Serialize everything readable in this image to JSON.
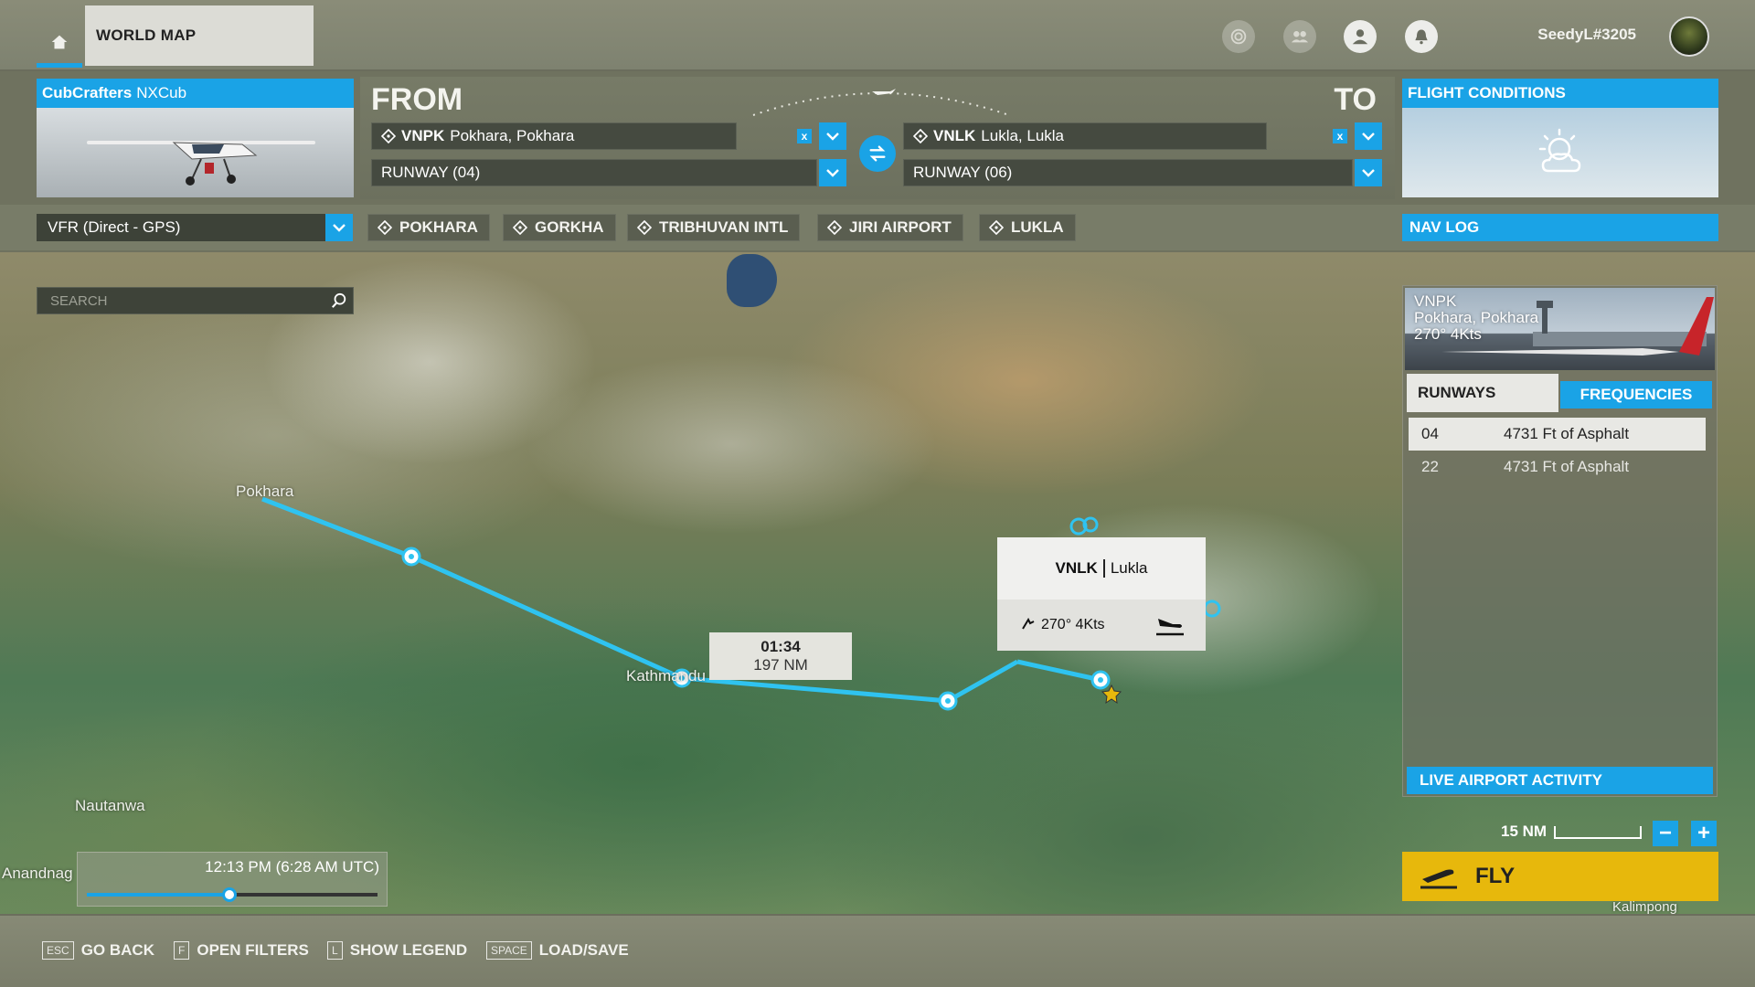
{
  "header": {
    "worldmap_tab": "WORLD MAP",
    "username": "SeedyL#3205",
    "icons": [
      "home-icon",
      "activity-icon",
      "friends-icon",
      "profile-icon",
      "notifications-icon"
    ]
  },
  "aircraft": {
    "brand": "CubCrafters",
    "model": "NXCub"
  },
  "route": {
    "from_label": "FROM",
    "to_label": "TO",
    "from_code": "VNPK",
    "from_name": "Pokhara, Pokhara",
    "from_runway": "RUNWAY (04)",
    "to_code": "VNLK",
    "to_name": "Lukla, Lukla",
    "to_runway": "RUNWAY (06)",
    "clear_label": "x"
  },
  "conditions": {
    "title": "FLIGHT CONDITIONS",
    "icon": "partly-cloudy-icon"
  },
  "flight_plan": {
    "type": "VFR (Direct - GPS)",
    "waypoints": [
      "POKHARA",
      "GORKHA",
      "TRIBHUVAN INTL",
      "JIRI AIRPORT",
      "LUKLA"
    ],
    "navlog_label": "NAV LOG"
  },
  "search": {
    "placeholder": "SEARCH"
  },
  "map": {
    "places": [
      "Pokhara",
      "Kathmandu",
      "Nautanwa",
      "Anandnag",
      "Kalimpong"
    ],
    "leg_time": "01:34",
    "leg_distance": "197 NM",
    "popup_code": "VNLK",
    "popup_name": "Lukla",
    "popup_wind": "270° 4Kts",
    "scale_label": "15 NM"
  },
  "time": {
    "display": "12:13 PM (6:28 AM UTC)",
    "progress": 0.49
  },
  "airport_panel": {
    "code": "VNPK",
    "name": "Pokhara, Pokhara",
    "wind": "270° 4Kts",
    "tab_runways": "RUNWAYS",
    "tab_frequencies": "FREQUENCIES",
    "runways": [
      {
        "num": "04",
        "desc": "4731 Ft of Asphalt"
      },
      {
        "num": "22",
        "desc": "4731 Ft of Asphalt"
      }
    ],
    "live_activity": "LIVE AIRPORT ACTIVITY"
  },
  "zoom": {
    "minus": "−",
    "plus": "+"
  },
  "fly_label": "FLY",
  "footer": {
    "hints": [
      {
        "key": "ESC",
        "label": "GO BACK"
      },
      {
        "key": "F",
        "label": "OPEN FILTERS"
      },
      {
        "key": "L",
        "label": "SHOW LEGEND"
      },
      {
        "key": "SPACE",
        "label": "LOAD/SAVE"
      }
    ]
  },
  "colors": {
    "accent": "#1aa3e6",
    "fly": "#e7b80c",
    "route": "#2fc3f0"
  }
}
